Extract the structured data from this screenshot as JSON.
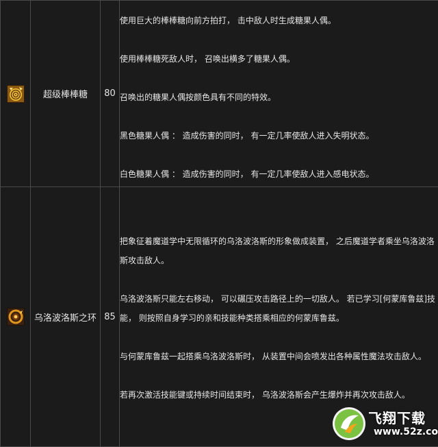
{
  "skills": [
    {
      "icon": "candy-spiral-icon",
      "name": "超级棒棒糖",
      "level": "80",
      "desc": [
        "使用巨大的棒棒糖向前方拍打， 击中敌人时生成糖果人偶。",
        "使用棒棒糖死敌人时， 召唤出横多了糖果人偶。",
        "召唤出的糖果人偶按颜色具有不同的特效。",
        "黑色糖果人偶 ： 造成伤害的同时， 有一定几率使敌人进入失明状态。",
        "白色糖果人偶 ： 造成伤害的同时， 有一定几率使敌人进入感电状态。"
      ]
    },
    {
      "icon": "ouroboros-ring-icon",
      "name": "乌洛波洛斯之环",
      "level": "85",
      "desc": [
        "把象征着魔道学中无限循环的乌洛波洛斯的形象做成装置， 之后魔道学者乘坐乌洛波洛斯攻击敌人。",
        "乌洛波洛斯只能左右移动， 可以碾压攻击路径上的一切敌人。 若已学习[何蒙库鲁兹]技能， 则按照自身学习的亲和技能种类搭乘相应的何蒙库鲁兹。",
        "与何蒙库鲁兹一起搭乘乌洛波洛斯时， 从装置中间会喷发出各种属性魔法攻击敌人。",
        "若再次激活技能键或持续时间结束时， 乌洛波洛斯会产生爆炸并再次攻击敌人。"
      ]
    }
  ],
  "watermark": {
    "text": "飞翔下载",
    "url": "www.52z.com"
  },
  "colors": {
    "background": "#1b1b1b",
    "border": "#4a4a4a",
    "text": "#e6e6e6"
  }
}
